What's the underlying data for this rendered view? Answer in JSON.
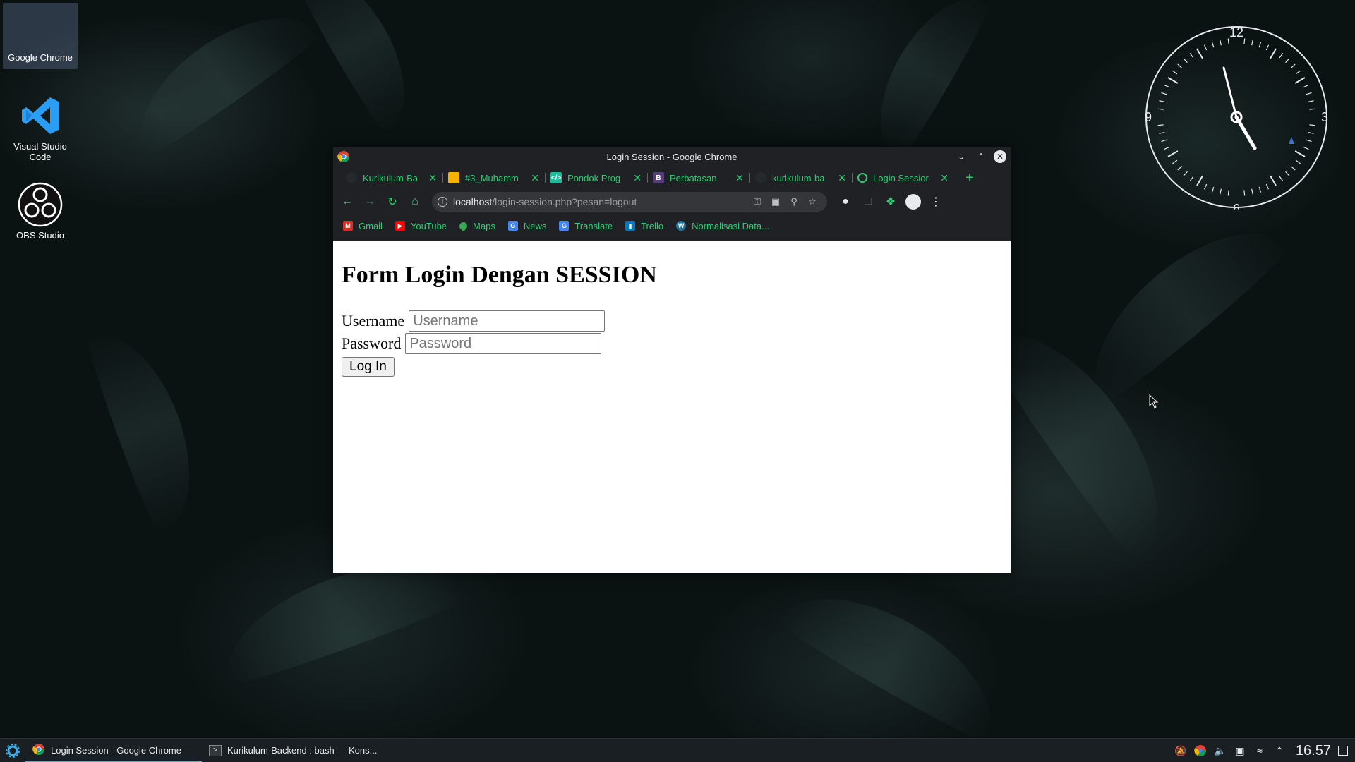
{
  "desktop": {
    "icons": [
      {
        "label": "Google Chrome"
      },
      {
        "label": "Visual Studio\nCode"
      },
      {
        "label": "OBS Studio"
      }
    ],
    "clock": {
      "numerals": [
        "12",
        "3",
        "6",
        "9"
      ]
    }
  },
  "window": {
    "title": "Login Session - Google Chrome",
    "tabs": [
      {
        "title": "Kurikulum-Ba",
        "icon": "github-icon"
      },
      {
        "title": "#3_Muhamm",
        "icon": "slides-icon"
      },
      {
        "title": "Pondok Prog",
        "icon": "code-icon"
      },
      {
        "title": "Perbatasan",
        "icon": "bootstrap-icon"
      },
      {
        "title": "kurikulum-ba",
        "icon": "github-icon"
      },
      {
        "title": "Login Sessior",
        "icon": "globe-icon"
      }
    ],
    "address": {
      "host": "localhost",
      "path": "/login-session.php?pesan=logout"
    },
    "bookmarks": [
      {
        "label": "Gmail",
        "color": "#d93025"
      },
      {
        "label": "YouTube",
        "color": "#ff0000"
      },
      {
        "label": "Maps",
        "color": "#34a853"
      },
      {
        "label": "News",
        "color": "#4285f4"
      },
      {
        "label": "Translate",
        "color": "#4285f4"
      },
      {
        "label": "Trello",
        "color": "#0079bf"
      },
      {
        "label": "Normalisasi Data...",
        "color": "#21759b"
      }
    ]
  },
  "page": {
    "heading": "Form Login Dengan SESSION",
    "username_label": "Username",
    "username_placeholder": "Username",
    "password_label": "Password",
    "password_placeholder": "Password",
    "login_button": "Log In"
  },
  "taskbar": {
    "tasks": [
      {
        "label": "Login Session - Google Chrome"
      },
      {
        "label": "Kurikulum-Backend : bash — Kons..."
      }
    ],
    "time": "16.57"
  },
  "colors": {
    "accent": "#2ecc71",
    "taskbar_active": "#3daee9"
  }
}
